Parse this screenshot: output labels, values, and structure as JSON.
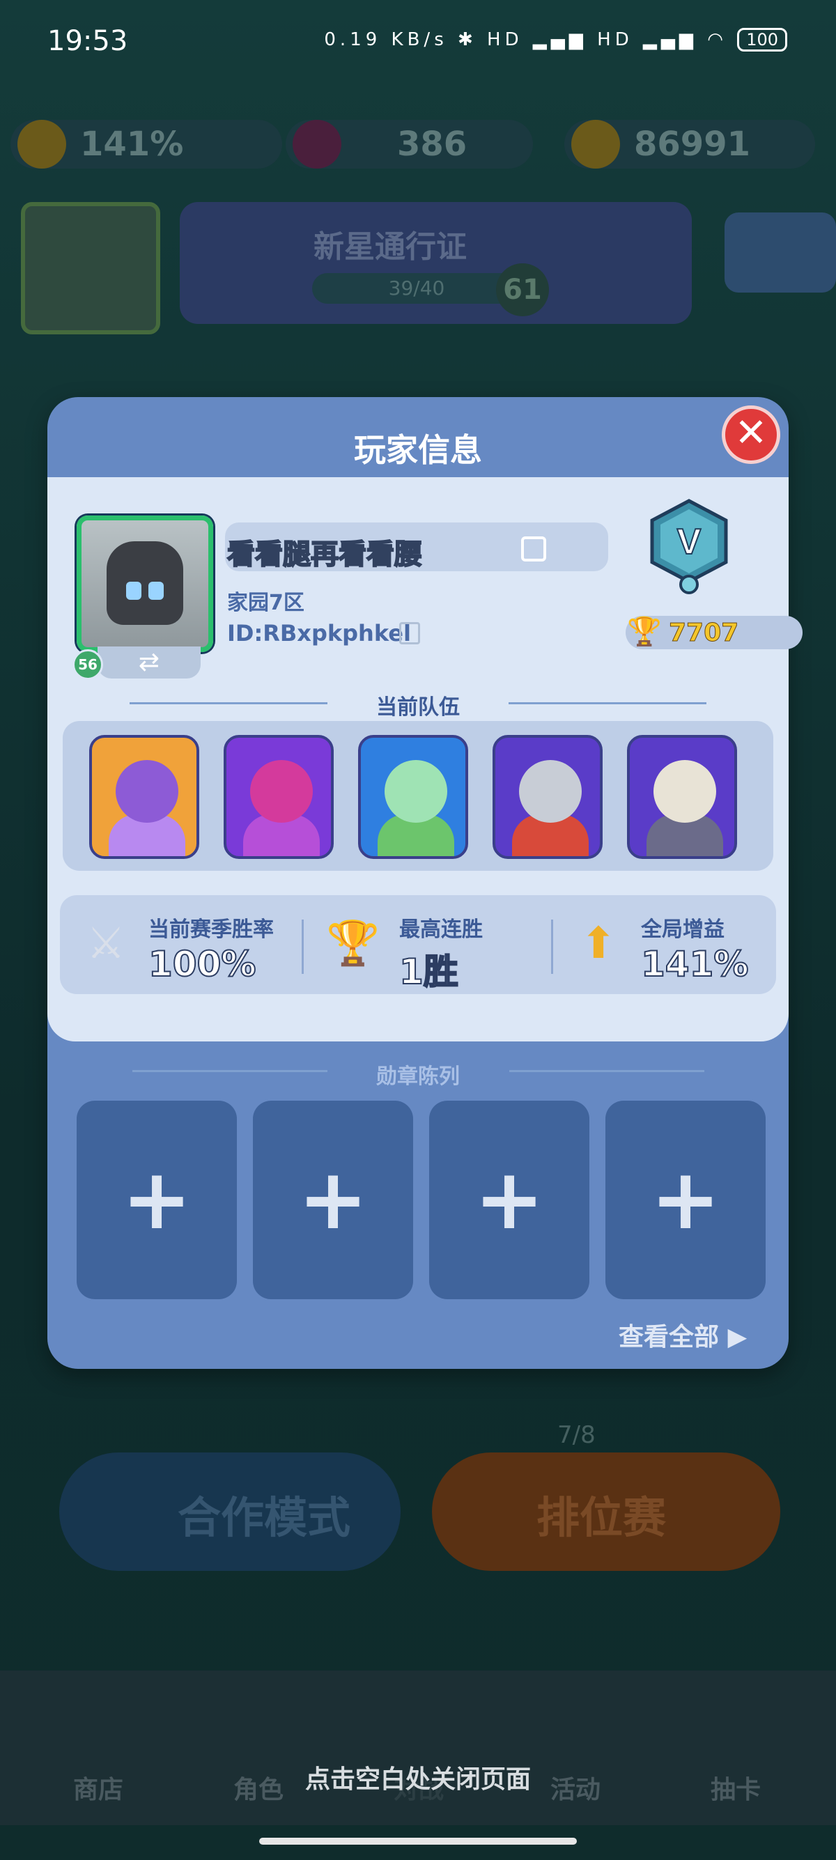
{
  "status_bar": {
    "time": "19:53",
    "icons": "0.19 KB/s ✱ HD ▂▄▆ HD ▂▄▆ ◠",
    "battery": "100"
  },
  "resources": {
    "boost": "141%",
    "gems": "386",
    "coins": "86991"
  },
  "pass": {
    "title": "新星通行证",
    "progress": "39/40",
    "level": "61"
  },
  "modes": {
    "coop": "合作模式",
    "ranked": "排位赛",
    "ranked_count": "7/8"
  },
  "nav": [
    "商店",
    "角色",
    "对战",
    "活动",
    "抽卡"
  ],
  "hint": "点击空白处关闭页面",
  "dialog": {
    "title": "玩家信息",
    "close": "✕",
    "profile": {
      "name": "看看腿再看看腰",
      "server": "家园7区",
      "id": "ID:RBxpkphkel",
      "level": "56",
      "rank_letter": "V",
      "trophies": "7707"
    },
    "team_title": "当前队伍",
    "team": [
      {
        "name": "hero-1",
        "colors": [
          "#f0a23a",
          "#8d5bd6",
          "#b889f0"
        ]
      },
      {
        "name": "hero-2",
        "colors": [
          "#7a3ad8",
          "#d43a9c",
          "#b64fd8"
        ]
      },
      {
        "name": "hero-3",
        "colors": [
          "#2f7fe0",
          "#9fe3b4",
          "#6cc56c"
        ]
      },
      {
        "name": "hero-4",
        "colors": [
          "#5a3cc8",
          "#c8cdd6",
          "#d84a3a"
        ]
      },
      {
        "name": "hero-5",
        "colors": [
          "#5a3cc8",
          "#e8e3d6",
          "#6b6b8a"
        ]
      }
    ],
    "stats": [
      {
        "label": "当前赛季胜率",
        "value": "100%",
        "icon": "⚔"
      },
      {
        "label": "最高连胜",
        "value": "1胜",
        "icon": "🏆"
      },
      {
        "label": "全局增益",
        "value": "141%",
        "icon": "⬆"
      }
    ],
    "medals_title": "勋章陈列",
    "medal_slots": [
      "+",
      "+",
      "+",
      "+"
    ],
    "view_all": "查看全部 ▶"
  }
}
